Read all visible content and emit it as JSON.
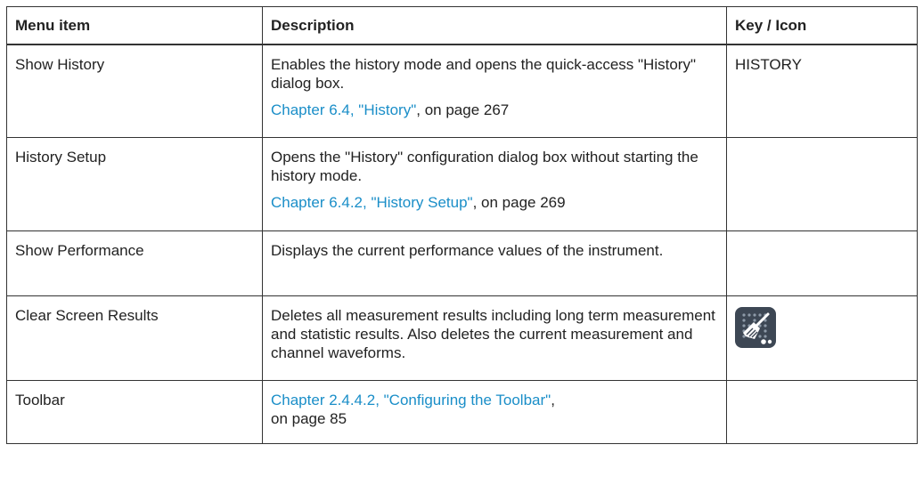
{
  "columns": {
    "menu_item": "Menu item",
    "description": "Description",
    "key_icon": "Key / Icon"
  },
  "rows": [
    {
      "item": "Show History",
      "description": "Enables the history mode and opens the quick-access \"History\" dialog box.",
      "link": "Chapter 6.4, \"History\"",
      "link_suffix": ", on page 267",
      "key": "HISTORY"
    },
    {
      "item": "History Setup",
      "description": "Opens the \"History\" configuration dialog box without starting the history mode.",
      "link": "Chapter 6.4.2, \"History Setup\"",
      "link_suffix": ", on page 269",
      "key": ""
    },
    {
      "item": "Show Performance",
      "description": "Displays the current performance values of the instrument.",
      "key": ""
    },
    {
      "item": "Clear Screen Results",
      "description": "Deletes all measurement results including long term measurement and statistic results. Also deletes the current measurement and channel waveforms.",
      "icon": "clear-results-broom-icon"
    },
    {
      "item": "Toolbar",
      "link": "Chapter 2.4.4.2, \"Configuring the Toolbar\"",
      "link_suffix": ", on page 85",
      "key": ""
    }
  ],
  "colors": {
    "link": "#1a8ec8",
    "icon_background": "#3d4754",
    "border": "#333333"
  }
}
